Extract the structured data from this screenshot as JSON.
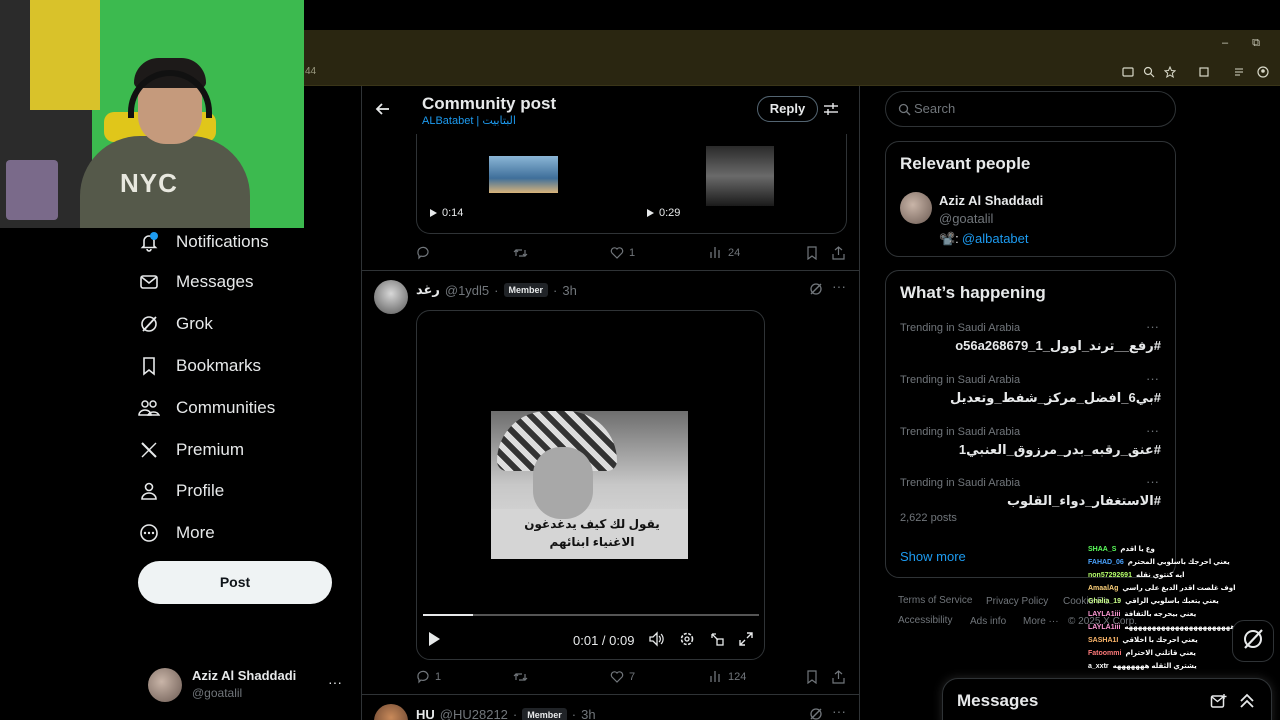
{
  "browser": {
    "addr_tail": "44",
    "window_buttons": [
      "–",
      "⧉"
    ],
    "ext_icons": [
      "cast-icon",
      "zoom-icon",
      "star-icon",
      "extensions-icon",
      "profile-icon"
    ]
  },
  "webcam": {
    "hoodie_text": "NYC"
  },
  "nav": {
    "items": [
      {
        "label": "Notifications",
        "icon": "bell-icon",
        "badge": "8"
      },
      {
        "label": "Messages",
        "icon": "envelope-icon"
      },
      {
        "label": "Grok",
        "icon": "grok-icon"
      },
      {
        "label": "Bookmarks",
        "icon": "bookmark-icon"
      },
      {
        "label": "Communities",
        "icon": "communities-icon"
      },
      {
        "label": "Premium",
        "icon": "x-logo-icon"
      },
      {
        "label": "Profile",
        "icon": "person-icon"
      },
      {
        "label": "More",
        "icon": "more-circle-icon"
      }
    ],
    "post_label": "Post"
  },
  "account": {
    "name": "Aziz Al Shaddadi",
    "handle": "@goatalil",
    "more": "···"
  },
  "header": {
    "title": "Community post",
    "subtitle": "ALBatabet | البتابيت",
    "reply_label": "Reply"
  },
  "post1": {
    "media": [
      {
        "duration": "0:14"
      },
      {
        "duration": "0:29"
      }
    ],
    "actions": {
      "replies": "",
      "reposts": "",
      "likes": "1",
      "views": "24"
    }
  },
  "post2": {
    "name": "رغد",
    "handle": "@1ydl5",
    "member": "Member",
    "time": "3h",
    "video": {
      "subtitle": "يقول لك كيف يدغدغون الاغنياء ابنائهم",
      "time": "0:01 / 0:09",
      "progress": 0.15
    },
    "actions": {
      "replies": "1",
      "reposts": "",
      "likes": "7",
      "views": "124"
    }
  },
  "post3": {
    "name": "HU",
    "handle": "@HU28212",
    "member": "Member",
    "time": "3h"
  },
  "search": {
    "placeholder": "Search"
  },
  "relevant": {
    "title": "Relevant people",
    "name": "Aziz Al Shaddadi",
    "handle": "@goatalil",
    "bio_link": "@albatabet",
    "bio_prefix": "📽️:"
  },
  "happening": {
    "title": "What’s happening",
    "trends": [
      {
        "context": "Trending in Saudi Arabia",
        "name": "#رفع__ترند_اوول_1_o56a268679"
      },
      {
        "context": "Trending in Saudi Arabia",
        "name": "#بي6_افضل_مركز_شفط_وتعديل"
      },
      {
        "context": "Trending in Saudi Arabia",
        "name": "#عنق_رقبه_بدر_مرزوق_العنبي1"
      },
      {
        "context": "Trending in Saudi Arabia",
        "name": "#الاستغفار_دواء_القلوب",
        "posts": "2,622 posts"
      }
    ],
    "show_more": "Show more"
  },
  "footer": {
    "links": [
      "Terms of Service",
      "Privacy Policy",
      "Cookie Po",
      "Accessibility",
      "Ads info",
      "More ···",
      "© 2025 X Corp."
    ]
  },
  "chat": [
    {
      "user": "SHAA_S",
      "msg": "وع يا اقدم",
      "color": "#5cff5c"
    },
    {
      "user": "FAHAD_06",
      "msg": "يعني احرجك باسلوبي المحترم",
      "color": "#4aa3ff"
    },
    {
      "user": "non57292691",
      "msg": "ايه كنتوي نقله",
      "color": "#b6ff6b"
    },
    {
      "user": "AmaalAg",
      "msg": "اوف غلصت اقدر الدبغ على راسي",
      "color": "#ffd27a"
    },
    {
      "user": "Ghalia_19",
      "msg": "يعني يتعبك باسلوبي الراقي",
      "color": "#c9ff8a"
    },
    {
      "user": "LAYLA1iii",
      "msg": "يعني بيحرجه بالتفافة",
      "color": "#ff9ad5"
    },
    {
      "user": "LAYLA1iii",
      "msg": "هههههههههههههههههههههههه",
      "color": "#ff9ad5"
    },
    {
      "user": "SASHA1I",
      "msg": "يعني احرجك با اخلاقي",
      "color": "#ffb86b"
    },
    {
      "user": "Fatoommi",
      "msg": "يعني قاتلني الاحترام",
      "color": "#ff7a7a"
    },
    {
      "user": "a_xxtr",
      "msg": "يشتري الثقله هههههههه",
      "color": "#ffffff"
    }
  ],
  "messages": {
    "title": "Messages"
  }
}
